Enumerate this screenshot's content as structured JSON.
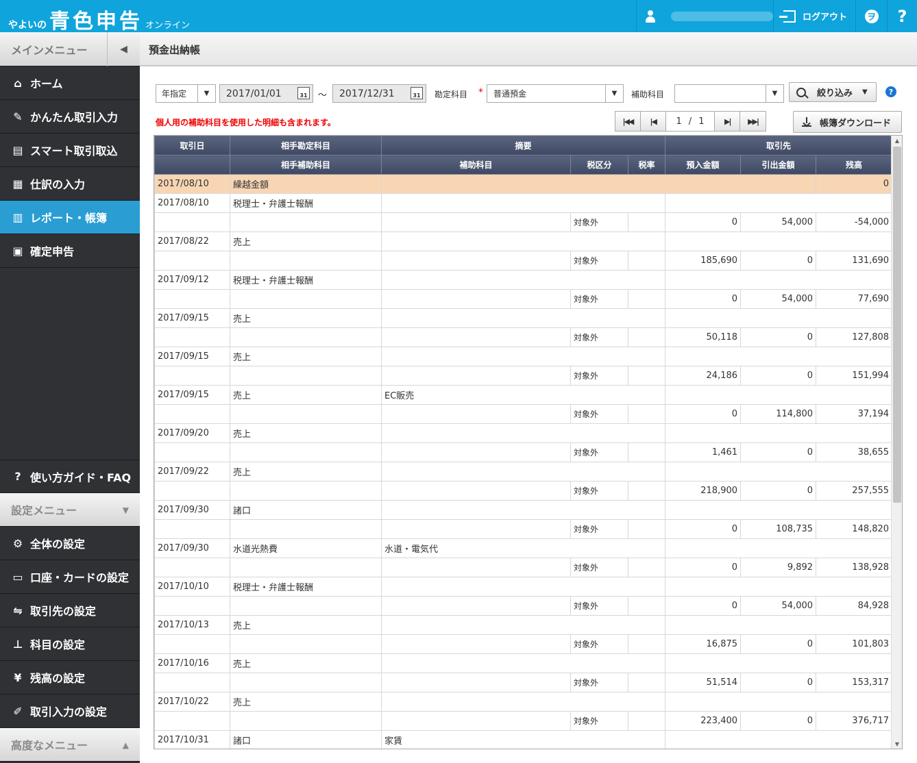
{
  "app": {
    "logo_small": "やよいの",
    "logo_big": "青色申告",
    "logo_online": "オンライン",
    "logout": "ログアウト",
    "help": "?"
  },
  "sidebar": {
    "main_menu": "メインメニュー",
    "items": [
      {
        "label": "ホーム",
        "icon": "home-icon"
      },
      {
        "label": "かんたん取引入力",
        "icon": "pencil-icon"
      },
      {
        "label": "スマート取引取込",
        "icon": "import-icon"
      },
      {
        "label": "仕訳の入力",
        "icon": "journal-icon"
      },
      {
        "label": "レポート・帳簿",
        "icon": "chart-icon"
      },
      {
        "label": "確定申告",
        "icon": "calculator-icon"
      }
    ],
    "guide": "使い方ガイド・FAQ",
    "settings_menu": "設定メニュー",
    "settings_items": [
      {
        "label": "全体の設定"
      },
      {
        "label": "口座・カードの設定"
      },
      {
        "label": "取引先の設定"
      },
      {
        "label": "科目の設定"
      },
      {
        "label": "残高の設定"
      },
      {
        "label": "取引入力の設定"
      }
    ],
    "advanced_menu": "高度なメニュー"
  },
  "page": {
    "title": "預金出納帳",
    "period_select": "年指定",
    "date_from": "2017/01/01",
    "date_to": "2017/12/31",
    "tilde": "～",
    "account_label": "勘定科目",
    "required_mark": "*",
    "account_value": "普通預金",
    "sub_account_label": "補助科目",
    "sub_account_value": "",
    "filter_button": "絞り込み",
    "notice": "個人用の補助科目を使用した明細も含まれます。",
    "page_current": "1",
    "page_sep": "/",
    "page_total": "1",
    "download_button": "帳簿ダウンロード",
    "calendar_day": "31"
  },
  "table": {
    "headers_row1": [
      "取引日",
      "相手勘定科目",
      "摘要",
      "取引先"
    ],
    "headers_row2": [
      "相手補助科目",
      "補助科目",
      "税区分",
      "税率",
      "預入金額",
      "引出金額",
      "残高"
    ],
    "carry_row": {
      "date": "2017/08/10",
      "label": "繰越金額",
      "balance": "0"
    },
    "rows": [
      {
        "date": "2017/08/10",
        "account": "税理士・弁護士報酬",
        "memo": "",
        "tax": "対象外",
        "deposit": "0",
        "withdraw": "54,000",
        "balance": "-54,000"
      },
      {
        "date": "2017/08/22",
        "account": "売上",
        "memo": "",
        "tax": "対象外",
        "deposit": "185,690",
        "withdraw": "0",
        "balance": "131,690"
      },
      {
        "date": "2017/09/12",
        "account": "税理士・弁護士報酬",
        "memo": "",
        "tax": "対象外",
        "deposit": "0",
        "withdraw": "54,000",
        "balance": "77,690"
      },
      {
        "date": "2017/09/15",
        "account": "売上",
        "memo": "",
        "tax": "対象外",
        "deposit": "50,118",
        "withdraw": "0",
        "balance": "127,808"
      },
      {
        "date": "2017/09/15",
        "account": "売上",
        "memo": "",
        "tax": "対象外",
        "deposit": "24,186",
        "withdraw": "0",
        "balance": "151,994"
      },
      {
        "date": "2017/09/15",
        "account": "売上",
        "memo": "EC販売",
        "tax": "対象外",
        "deposit": "0",
        "withdraw": "114,800",
        "balance": "37,194"
      },
      {
        "date": "2017/09/20",
        "account": "売上",
        "memo": "",
        "tax": "対象外",
        "deposit": "1,461",
        "withdraw": "0",
        "balance": "38,655"
      },
      {
        "date": "2017/09/22",
        "account": "売上",
        "memo": "",
        "tax": "対象外",
        "deposit": "218,900",
        "withdraw": "0",
        "balance": "257,555"
      },
      {
        "date": "2017/09/30",
        "account": "諸口",
        "memo": "",
        "tax": "対象外",
        "deposit": "0",
        "withdraw": "108,735",
        "balance": "148,820"
      },
      {
        "date": "2017/09/30",
        "account": "水道光熱費",
        "memo": "水道・電気代",
        "tax": "対象外",
        "deposit": "0",
        "withdraw": "9,892",
        "balance": "138,928"
      },
      {
        "date": "2017/10/10",
        "account": "税理士・弁護士報酬",
        "memo": "",
        "tax": "対象外",
        "deposit": "0",
        "withdraw": "54,000",
        "balance": "84,928"
      },
      {
        "date": "2017/10/13",
        "account": "売上",
        "memo": "",
        "tax": "対象外",
        "deposit": "16,875",
        "withdraw": "0",
        "balance": "101,803"
      },
      {
        "date": "2017/10/16",
        "account": "売上",
        "memo": "",
        "tax": "対象外",
        "deposit": "51,514",
        "withdraw": "0",
        "balance": "153,317"
      },
      {
        "date": "2017/10/22",
        "account": "売上",
        "memo": "",
        "tax": "対象外",
        "deposit": "223,400",
        "withdraw": "0",
        "balance": "376,717"
      },
      {
        "date": "2017/10/31",
        "account": "諸口",
        "memo": "家賃",
        "tax": null,
        "deposit": null,
        "withdraw": null,
        "balance": null
      }
    ]
  }
}
